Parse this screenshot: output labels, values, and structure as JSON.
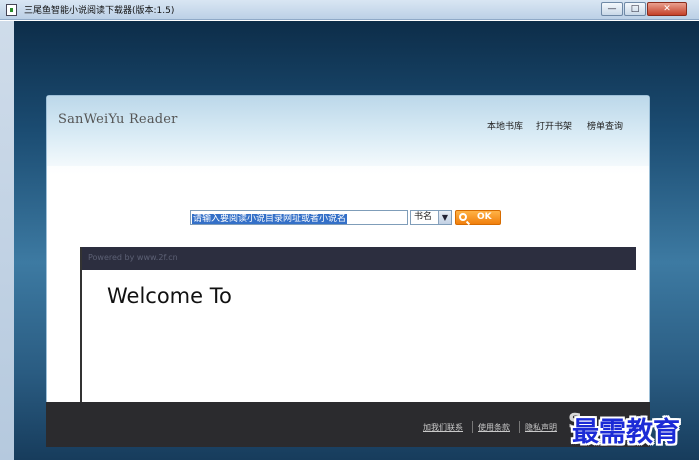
{
  "window": {
    "title": "三尾鱼智能小说阅读下载器(版本:1.5)",
    "controls": {
      "minimize": "—",
      "maximize": "□",
      "close": "✕"
    }
  },
  "header": {
    "logo": "SanWeiYu Reader",
    "nav": [
      "本地书库",
      "打开书架",
      "榜单查询"
    ]
  },
  "search": {
    "input_value": "请输入要阅读小说目录网址或者小说名",
    "type_selected": "书名",
    "type_options": [
      "书名"
    ],
    "ok_label": "OK"
  },
  "viewer": {
    "powered_by": "Powered by www.2f.cn",
    "welcome": "Welcome To"
  },
  "footer": {
    "links": [
      "加我们联系",
      "使用条款",
      "隐私声明"
    ],
    "logo_fragment": "S"
  },
  "watermark": "最需教育",
  "colors": {
    "accent": "#f07f0d",
    "viewer_bar": "#2c2e3f",
    "footer": "#2b2b2e",
    "watermark": "#1c2bd6"
  }
}
